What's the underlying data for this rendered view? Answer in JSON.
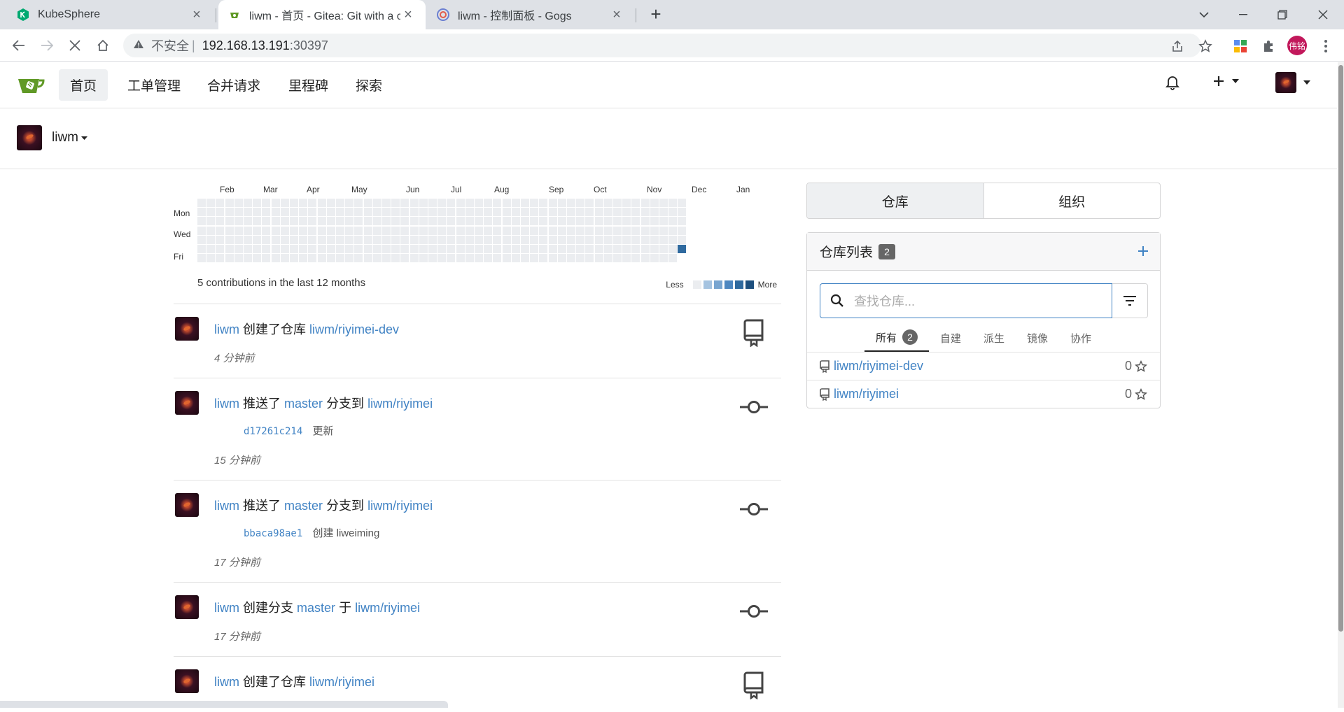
{
  "browser": {
    "tabs": [
      {
        "title": "KubeSphere",
        "active": false
      },
      {
        "title": "liwm - 首页 - Gitea: Git with a cup of tea",
        "active": true
      },
      {
        "title": "liwm - 控制面板 - Gogs",
        "active": false
      }
    ],
    "address": {
      "security": "不安全",
      "host": "192.168.13.191",
      "port": ":30397"
    },
    "profile_label": "伟铭"
  },
  "nav": {
    "items": [
      "首页",
      "工单管理",
      "合并请求",
      "里程碑",
      "探索"
    ],
    "active_index": 0
  },
  "context": {
    "username": "liwm"
  },
  "heatmap": {
    "months": [
      "Feb",
      "Mar",
      "Apr",
      "May",
      "Jun",
      "Jul",
      "Aug",
      "Sep",
      "Oct",
      "Nov",
      "Dec",
      "Jan"
    ],
    "days": [
      "Mon",
      "Wed",
      "Fri"
    ],
    "caption": "5 contributions in the last 12 months",
    "legend_less": "Less",
    "legend_more": "More",
    "legend_colors": [
      "#ebedf0",
      "#a5c3e0",
      "#78a5d0",
      "#4d87c0",
      "#2f6a9f",
      "#1d4f7e"
    ]
  },
  "feed": [
    {
      "user": "liwm",
      "verb": "创建了仓库",
      "target": "liwm/riyimei-dev",
      "time": "4 分钟前",
      "icon": "repo-icon"
    },
    {
      "user": "liwm",
      "verb": "推送了",
      "branch": "master",
      "mid": "分支到",
      "target": "liwm/riyimei",
      "sha": "d17261c214",
      "msg": "更新",
      "time": "15 分钟前",
      "icon": "commit-icon"
    },
    {
      "user": "liwm",
      "verb": "推送了",
      "branch": "master",
      "mid": "分支到",
      "target": "liwm/riyimei",
      "sha": "bbaca98ae1",
      "msg": "创建 liweiming",
      "time": "17 分钟前",
      "icon": "commit-icon"
    },
    {
      "user": "liwm",
      "verb": "创建分支",
      "branch": "master",
      "mid": "于",
      "target": "liwm/riyimei",
      "time": "17 分钟前",
      "icon": "commit-icon"
    },
    {
      "user": "liwm",
      "verb": "创建了仓库",
      "target": "liwm/riyimei",
      "time": "",
      "icon": "repo-icon"
    }
  ],
  "sidepanel": {
    "segments": [
      "仓库",
      "组织"
    ],
    "repo_header": "仓库列表",
    "repo_count": "2",
    "search_placeholder": "查找仓库...",
    "filter_tabs": [
      "所有",
      "自建",
      "派生",
      "镜像",
      "协作"
    ],
    "all_count": "2",
    "repos": [
      {
        "name": "liwm/riyimei-dev",
        "stars": "0"
      },
      {
        "name": "liwm/riyimei",
        "stars": "0"
      }
    ]
  }
}
